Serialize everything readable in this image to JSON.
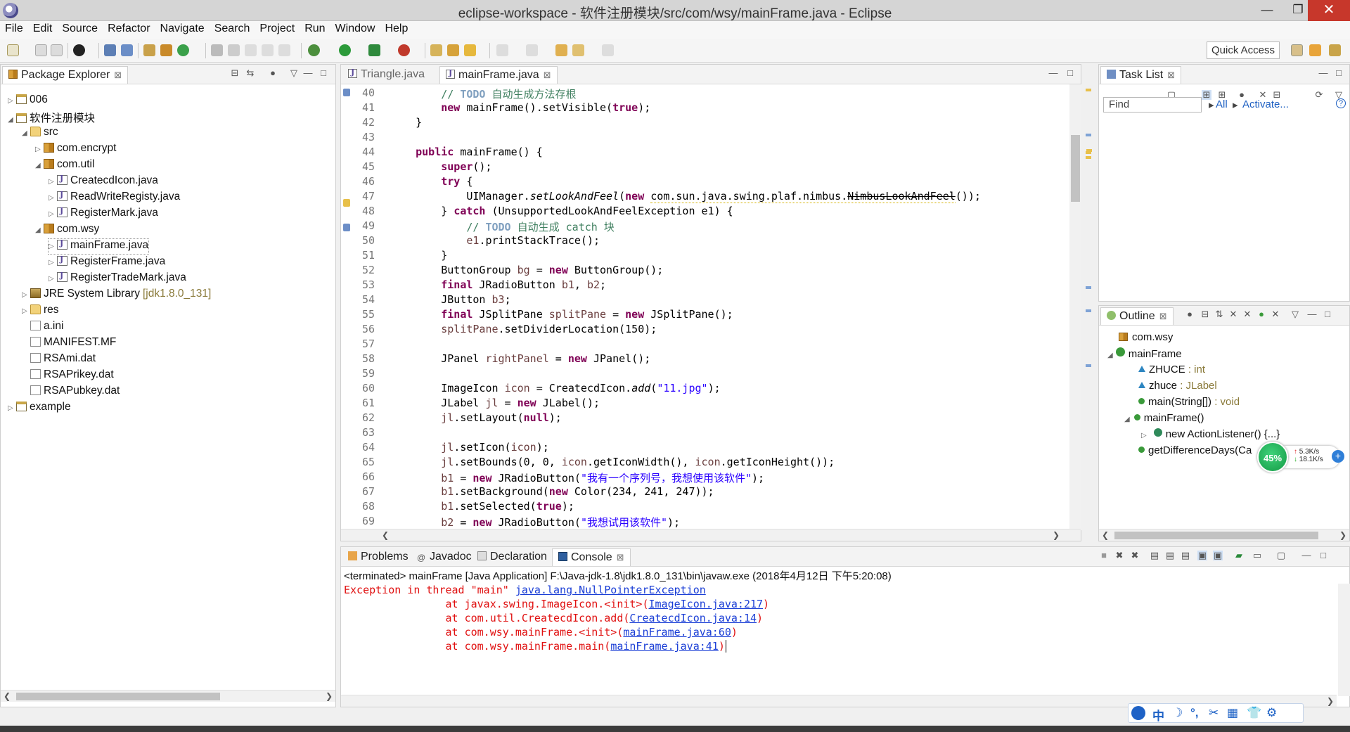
{
  "window": {
    "title": "eclipse-workspace - 软件注册模块/src/com/wsy/mainFrame.java - Eclipse",
    "min_glyph": "—",
    "max_glyph": "❐",
    "close_glyph": "✕"
  },
  "menu": [
    "File",
    "Edit",
    "Source",
    "Refactor",
    "Navigate",
    "Search",
    "Project",
    "Run",
    "Window",
    "Help"
  ],
  "toolbar": {
    "quick_access": "Quick Access"
  },
  "package_explorer": {
    "title": "Package Explorer",
    "items": [
      {
        "label": "006",
        "deco": ""
      },
      {
        "label": "软件注册模块",
        "deco": ""
      },
      {
        "label": "src",
        "deco": ""
      },
      {
        "label": "com.encrypt",
        "deco": ""
      },
      {
        "label": "com.util",
        "deco": ""
      },
      {
        "label": "CreatecdIcon.java",
        "deco": ""
      },
      {
        "label": "ReadWriteRegisty.java",
        "deco": ""
      },
      {
        "label": "RegisterMark.java",
        "deco": ""
      },
      {
        "label": "com.wsy",
        "deco": ""
      },
      {
        "label": "mainFrame.java",
        "deco": ""
      },
      {
        "label": "RegisterFrame.java",
        "deco": ""
      },
      {
        "label": "RegisterTradeMark.java",
        "deco": ""
      },
      {
        "label": "JRE System Library",
        "deco": "[jdk1.8.0_131]"
      },
      {
        "label": "res",
        "deco": ""
      },
      {
        "label": "a.ini",
        "deco": ""
      },
      {
        "label": "MANIFEST.MF",
        "deco": ""
      },
      {
        "label": "RSAmi.dat",
        "deco": ""
      },
      {
        "label": "RSAPrikey.dat",
        "deco": ""
      },
      {
        "label": "RSAPubkey.dat",
        "deco": ""
      },
      {
        "label": "example",
        "deco": ""
      }
    ]
  },
  "editor": {
    "tabs": [
      "Triangle.java",
      "mainFrame.java"
    ],
    "line_numbers": [
      "40",
      "41",
      "42",
      "43",
      "44",
      "45",
      "46",
      "47",
      "48",
      "49",
      "50",
      "51",
      "52",
      "53",
      "54",
      "55",
      "56",
      "57",
      "58",
      "59",
      "60",
      "61",
      "62",
      "63",
      "64",
      "65",
      "66",
      "67",
      "68",
      "69"
    ]
  },
  "task_list": {
    "title": "Task List",
    "find_placeholder": "Find",
    "all_label": "All",
    "activate_label": "Activate..."
  },
  "outline": {
    "title": "Outline",
    "items": [
      {
        "label": "com.wsy",
        "type": ""
      },
      {
        "label": "mainFrame",
        "type": ""
      },
      {
        "label": "ZHUCE",
        "type": " : int"
      },
      {
        "label": "zhuce",
        "type": " : JLabel"
      },
      {
        "label": "main(String[])",
        "type": " : void"
      },
      {
        "label": "mainFrame()",
        "type": ""
      },
      {
        "label": "new ActionListener() {...}",
        "type": ""
      },
      {
        "label": "getDifferenceDays(Ca",
        "type": ""
      }
    ]
  },
  "bottom_tabs": [
    "Problems",
    "Javadoc",
    "Declaration",
    "Console"
  ],
  "console": {
    "header": "<terminated> mainFrame [Java Application] F:\\Java-jdk-1.8\\jdk1.8.0_131\\bin\\javaw.exe (2018年4月12日 下午5:20:08)",
    "line1_prefix": "Exception in thread \"main\" ",
    "line1_link": "java.lang.NullPointerException",
    "frames": [
      {
        "prefix": "\tat javax.swing.ImageIcon.<init>(",
        "link": "ImageIcon.java:217",
        "suffix": ")"
      },
      {
        "prefix": "\tat com.util.CreatecdIcon.add(",
        "link": "CreatecdIcon.java:14",
        "suffix": ")"
      },
      {
        "prefix": "\tat com.wsy.mainFrame.<init>(",
        "link": "mainFrame.java:60",
        "suffix": ")"
      },
      {
        "prefix": "\tat com.wsy.mainFrame.main(",
        "link": "mainFrame.java:41",
        "suffix": ")"
      }
    ]
  },
  "speed_widget": {
    "percent": "45%",
    "up_rate": "5.3K/s",
    "down_rate": "18.1K/s",
    "plus": "+"
  },
  "ime_bar": [
    "中",
    "☽",
    "°,",
    "✂",
    "▦",
    "👕",
    "⚙"
  ]
}
